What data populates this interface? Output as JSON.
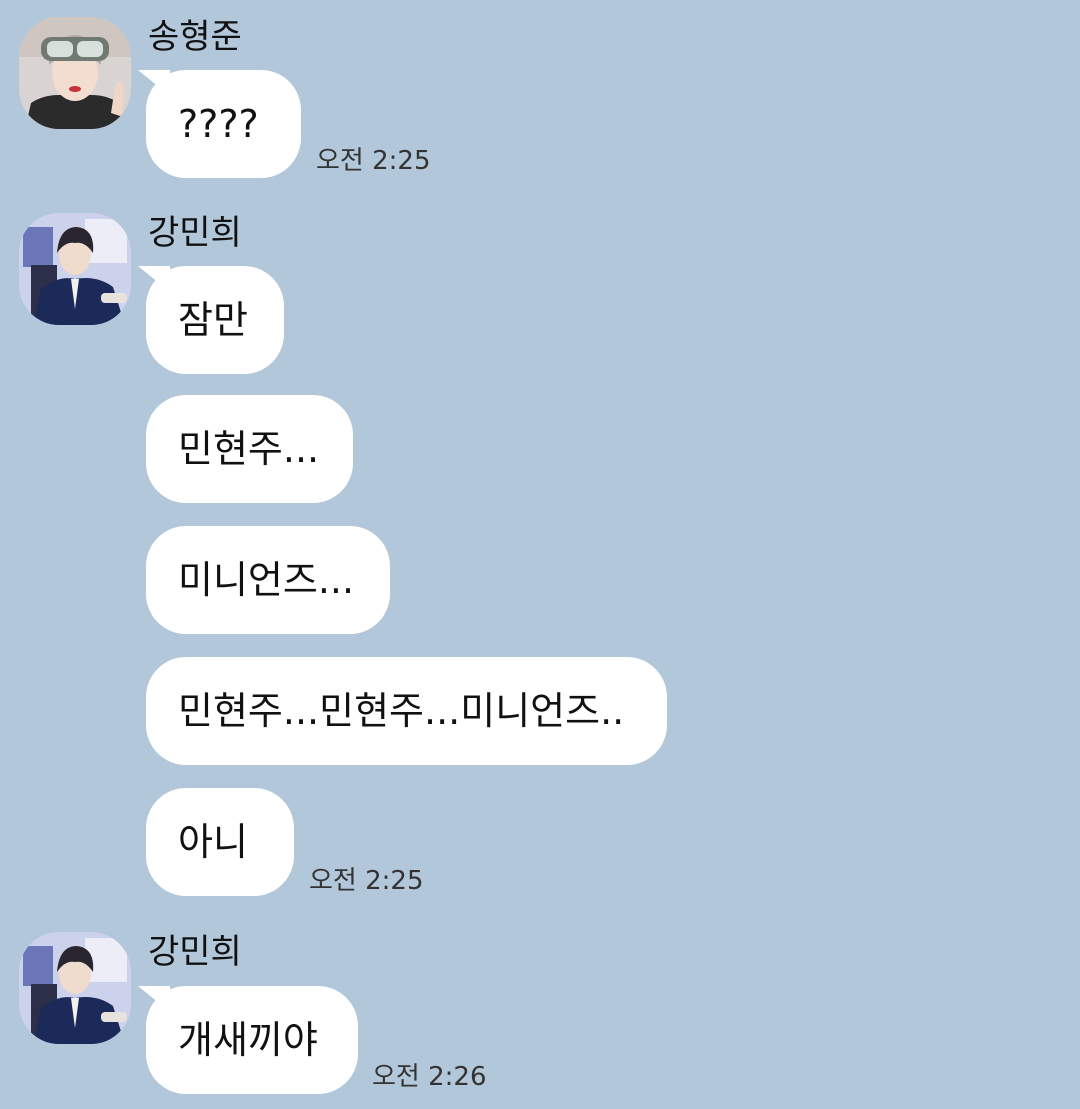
{
  "messages": [
    {
      "sender": "송형준",
      "bubbles": [
        "????"
      ],
      "time": "오전 2:25"
    },
    {
      "sender": "강민희",
      "bubbles": [
        "잠만",
        "민현주...",
        "미니언즈...",
        "민현주...민현주...미니언즈..",
        "아니"
      ],
      "time": "오전 2:25"
    },
    {
      "sender": "강민희",
      "bubbles": [
        "개새끼야"
      ],
      "time": "오전 2:26"
    }
  ]
}
